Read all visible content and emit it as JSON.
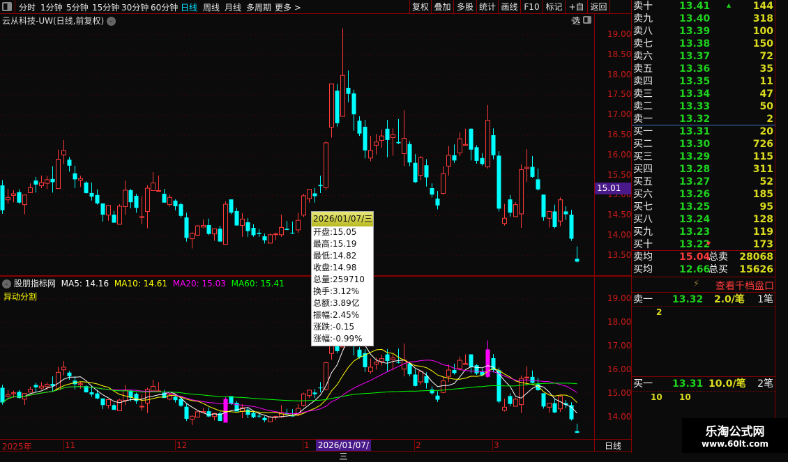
{
  "toolbar": {
    "periods": [
      "分时",
      "1分钟",
      "5分钟",
      "15分钟",
      "30分钟",
      "60分钟",
      "日线",
      "周线",
      "月线",
      "多周期",
      "更多 >"
    ],
    "active_period": "日线",
    "buttons": [
      "复权",
      "叠加",
      "多股",
      "统计",
      "画线",
      "F10",
      "标记",
      "+自选",
      "返回"
    ]
  },
  "chart": {
    "title": "云从科技-UW(日线,前复权)",
    "price_labels": [
      "19.00",
      "18.50",
      "18.00",
      "17.50",
      "17.00",
      "16.50",
      "16.00",
      "15.50",
      "15.00",
      "14.50",
      "14.00",
      "13.50"
    ],
    "current_price_marker": "15.01",
    "lower_labels": [
      "19.00",
      "18.00",
      "17.00",
      "16.00",
      "15.00",
      "14.00"
    ]
  },
  "indicator": {
    "name": "股朋指标网",
    "ma5": "MA5: 14.16",
    "ma10": "MA10: 14.61",
    "ma20": "MA20: 15.03",
    "ma60": "MA60: 15.41",
    "subtitle": "异动分割"
  },
  "colors": {
    "up": "#ff3a3a",
    "down": "#00ffff",
    "highlight": "#ff00ff",
    "ma5": "#ffffff",
    "ma10": "#ffff00",
    "ma20": "#ff00ff",
    "ma60": "#00ff00"
  },
  "tooltip": {
    "date": "2026/01/07/三",
    "rows": [
      "开盘:15.05",
      "最高:15.19",
      "最低:14.82",
      "收盘:14.98",
      "总量:259710",
      "换手:3.12%",
      "总额:3.89亿",
      "振幅:2.45%",
      "涨跌:-0.15",
      "涨幅:-0.99%"
    ]
  },
  "xaxis": {
    "labels": [
      "2025年",
      "11",
      "12",
      "1",
      "2",
      "3"
    ],
    "selected": "2026/01/07/三",
    "period": "日线"
  },
  "chart_data": {
    "type": "candlestick",
    "fields": [
      "open",
      "high",
      "low",
      "close"
    ],
    "selected_index": 56,
    "highlight_indices": [
      40,
      87
    ],
    "ylim": [
      13.3,
      19.2
    ],
    "candles": [
      [
        15.25,
        15.38,
        14.54,
        14.63
      ],
      [
        14.89,
        15.16,
        14.79,
        14.95
      ],
      [
        15.0,
        15.13,
        14.83,
        15.04
      ],
      [
        15.08,
        15.15,
        14.79,
        14.82
      ],
      [
        14.77,
        15.02,
        14.53,
        15.01
      ],
      [
        15.07,
        15.3,
        15.06,
        15.19
      ],
      [
        15.37,
        15.46,
        15.07,
        15.27
      ],
      [
        15.24,
        15.49,
        15.18,
        15.32
      ],
      [
        15.3,
        15.48,
        15.16,
        15.39
      ],
      [
        15.41,
        15.73,
        15.07,
        15.33
      ],
      [
        15.17,
        16.14,
        15.17,
        15.9
      ],
      [
        16.01,
        16.38,
        15.78,
        16.12
      ],
      [
        15.89,
        15.96,
        15.59,
        15.74
      ],
      [
        15.55,
        15.74,
        15.18,
        15.4
      ],
      [
        15.38,
        15.49,
        15.21,
        15.42
      ],
      [
        15.32,
        15.35,
        15.04,
        15.06
      ],
      [
        15.06,
        15.32,
        14.87,
        14.97
      ],
      [
        15.01,
        15.15,
        14.77,
        14.8
      ],
      [
        14.8,
        14.8,
        14.35,
        14.52
      ],
      [
        14.51,
        14.76,
        14.37,
        14.75
      ],
      [
        14.52,
        14.61,
        14.32,
        14.32
      ],
      [
        14.28,
        14.78,
        14.27,
        14.73
      ],
      [
        14.72,
        15.37,
        14.52,
        15.13
      ],
      [
        15.13,
        15.16,
        14.68,
        14.83
      ],
      [
        14.99,
        15.04,
        14.57,
        14.69
      ],
      [
        14.45,
        14.97,
        14.28,
        14.47
      ],
      [
        14.6,
        15.25,
        14.18,
        15.18
      ],
      [
        15.12,
        15.58,
        15.12,
        15.31
      ],
      [
        15.11,
        15.49,
        15.09,
        15.12
      ],
      [
        15.04,
        15.16,
        14.82,
        14.82
      ],
      [
        14.77,
        15.02,
        14.72,
        14.95
      ],
      [
        14.87,
        14.9,
        14.63,
        14.73
      ],
      [
        14.78,
        14.82,
        14.44,
        14.49
      ],
      [
        14.45,
        14.57,
        13.85,
        13.94
      ],
      [
        13.92,
        14.08,
        13.68,
        14.05
      ],
      [
        14.01,
        14.26,
        13.99,
        14.24
      ],
      [
        14.21,
        14.4,
        14.21,
        14.25
      ],
      [
        14.26,
        14.42,
        14.01,
        14.04
      ],
      [
        14.04,
        14.17,
        13.87,
        14.17
      ],
      [
        14.17,
        14.24,
        13.85,
        13.85
      ],
      [
        13.78,
        14.85,
        13.78,
        14.78
      ],
      [
        14.9,
        14.9,
        14.53,
        14.57
      ],
      [
        14.61,
        14.69,
        14.25,
        14.25
      ],
      [
        14.25,
        14.56,
        13.97,
        14.41
      ],
      [
        14.33,
        14.43,
        13.97,
        14.11
      ],
      [
        14.19,
        14.28,
        13.97,
        14.01
      ],
      [
        14.07,
        14.16,
        13.97,
        14.04
      ],
      [
        13.98,
        14.05,
        13.8,
        13.88
      ],
      [
        13.81,
        14.05,
        13.81,
        14.02
      ],
      [
        14.03,
        14.07,
        13.88,
        14.04
      ],
      [
        14.02,
        14.52,
        13.97,
        14.2
      ],
      [
        14.17,
        14.36,
        14.13,
        14.14
      ],
      [
        14.07,
        14.35,
        14.04,
        14.05
      ],
      [
        14.14,
        14.57,
        14.06,
        14.38
      ],
      [
        14.51,
        15.04,
        14.46,
        14.99
      ],
      [
        14.92,
        15.15,
        14.82,
        15.15
      ],
      [
        15.05,
        15.19,
        14.82,
        14.98
      ],
      [
        15.26,
        15.49,
        15.06,
        15.23
      ],
      [
        15.19,
        16.34,
        15.13,
        16.31
      ],
      [
        16.7,
        17.78,
        16.44,
        17.78
      ],
      [
        17.61,
        17.78,
        16.71,
        16.8
      ],
      [
        16.97,
        19.16,
        16.97,
        17.99
      ],
      [
        17.68,
        18.11,
        17.32,
        17.53
      ],
      [
        17.54,
        17.63,
        16.61,
        17.02
      ],
      [
        16.86,
        16.97,
        16.48,
        16.54
      ],
      [
        16.71,
        16.88,
        15.92,
        16.12
      ],
      [
        15.93,
        16.48,
        15.85,
        16.12
      ],
      [
        16.25,
        16.53,
        16.02,
        16.33
      ],
      [
        16.37,
        16.64,
        16.19,
        16.48
      ],
      [
        16.66,
        16.88,
        15.95,
        16.38
      ],
      [
        16.44,
        16.67,
        15.99,
        16.51
      ],
      [
        16.33,
        16.9,
        16.28,
        16.3
      ],
      [
        16.04,
        17.12,
        15.73,
        16.42
      ],
      [
        16.28,
        16.35,
        15.73,
        15.82
      ],
      [
        15.81,
        16.03,
        15.31,
        15.33
      ],
      [
        15.5,
        15.98,
        15.38,
        15.94
      ],
      [
        15.75,
        15.9,
        15.22,
        15.45
      ],
      [
        15.18,
        15.3,
        14.95,
        15.02
      ],
      [
        14.92,
        15.11,
        14.65,
        14.75
      ],
      [
        15.05,
        15.73,
        15.02,
        15.54
      ],
      [
        15.73,
        16.23,
        15.5,
        16.0
      ],
      [
        16.0,
        16.27,
        15.81,
        15.87
      ],
      [
        16.06,
        16.57,
        15.98,
        16.41
      ],
      [
        16.25,
        16.66,
        16.25,
        16.27
      ],
      [
        16.66,
        16.67,
        15.87,
        16.14
      ],
      [
        16.2,
        16.25,
        15.79,
        15.86
      ],
      [
        15.93,
        16.05,
        15.74,
        15.78
      ],
      [
        15.71,
        17.25,
        15.67,
        16.87
      ],
      [
        16.5,
        16.67,
        15.9,
        16.0
      ],
      [
        15.99,
        16.1,
        14.6,
        14.67
      ],
      [
        14.3,
        14.79,
        14.25,
        14.43
      ],
      [
        14.9,
        15.01,
        14.47,
        14.57
      ],
      [
        14.47,
        14.83,
        14.47,
        14.77
      ],
      [
        14.54,
        15.77,
        14.19,
        15.64
      ],
      [
        15.67,
        16.15,
        15.34,
        15.7
      ],
      [
        15.71,
        15.98,
        15.44,
        15.46
      ],
      [
        15.4,
        15.67,
        15.12,
        15.15
      ],
      [
        15.02,
        15.02,
        14.37,
        14.46
      ],
      [
        14.43,
        14.6,
        14.2,
        14.6
      ],
      [
        14.6,
        14.77,
        14.18,
        14.21
      ],
      [
        14.36,
        14.95,
        14.23,
        14.89
      ],
      [
        14.6,
        14.73,
        14.39,
        14.53
      ],
      [
        14.52,
        14.64,
        13.87,
        13.92
      ],
      [
        13.42,
        13.73,
        13.33,
        13.35
      ]
    ]
  },
  "orderbook": {
    "asks": [
      {
        "label": "卖十",
        "price": "13.41",
        "vol": "144"
      },
      {
        "label": "卖九",
        "price": "13.40",
        "vol": "318"
      },
      {
        "label": "卖八",
        "price": "13.39",
        "vol": "100"
      },
      {
        "label": "卖七",
        "price": "13.38",
        "vol": "150"
      },
      {
        "label": "卖六",
        "price": "13.37",
        "vol": "72"
      },
      {
        "label": "卖五",
        "price": "13.36",
        "vol": "35"
      },
      {
        "label": "卖四",
        "price": "13.35",
        "vol": "11"
      },
      {
        "label": "卖三",
        "price": "13.34",
        "vol": "47"
      },
      {
        "label": "卖二",
        "price": "13.33",
        "vol": "50"
      },
      {
        "label": "卖一",
        "price": "13.32",
        "vol": "2"
      }
    ],
    "bids": [
      {
        "label": "买一",
        "price": "13.31",
        "vol": "20"
      },
      {
        "label": "买二",
        "price": "13.30",
        "vol": "726"
      },
      {
        "label": "买三",
        "price": "13.29",
        "vol": "115"
      },
      {
        "label": "买四",
        "price": "13.28",
        "vol": "311"
      },
      {
        "label": "买五",
        "price": "13.27",
        "vol": "52"
      },
      {
        "label": "买六",
        "price": "13.26",
        "vol": "185"
      },
      {
        "label": "买七",
        "price": "13.25",
        "vol": "95"
      },
      {
        "label": "买八",
        "price": "13.24",
        "vol": "128"
      },
      {
        "label": "买九",
        "price": "13.23",
        "vol": "119"
      },
      {
        "label": "买十",
        "price": "13.22",
        "vol": "173"
      }
    ],
    "ask_avg": {
      "label": "卖均",
      "price": "15.04",
      "total_label": "总卖",
      "total": "28068"
    },
    "bid_avg": {
      "label": "买均",
      "price": "12.66",
      "total_label": "总买",
      "total": "15626"
    },
    "depth_link": "查看千档盘口",
    "ask1": {
      "label": "卖一",
      "price": "13.32",
      "per": "2.0/笔",
      "count": "1笔",
      "orders": [
        "2"
      ]
    },
    "bid1": {
      "label": "买一",
      "price": "13.31",
      "per": "10.0/笔",
      "count": "2笔",
      "orders": [
        "10",
        "10"
      ]
    }
  },
  "watermark": {
    "name": "乐淘公式网",
    "url": "www.60lt.com"
  }
}
